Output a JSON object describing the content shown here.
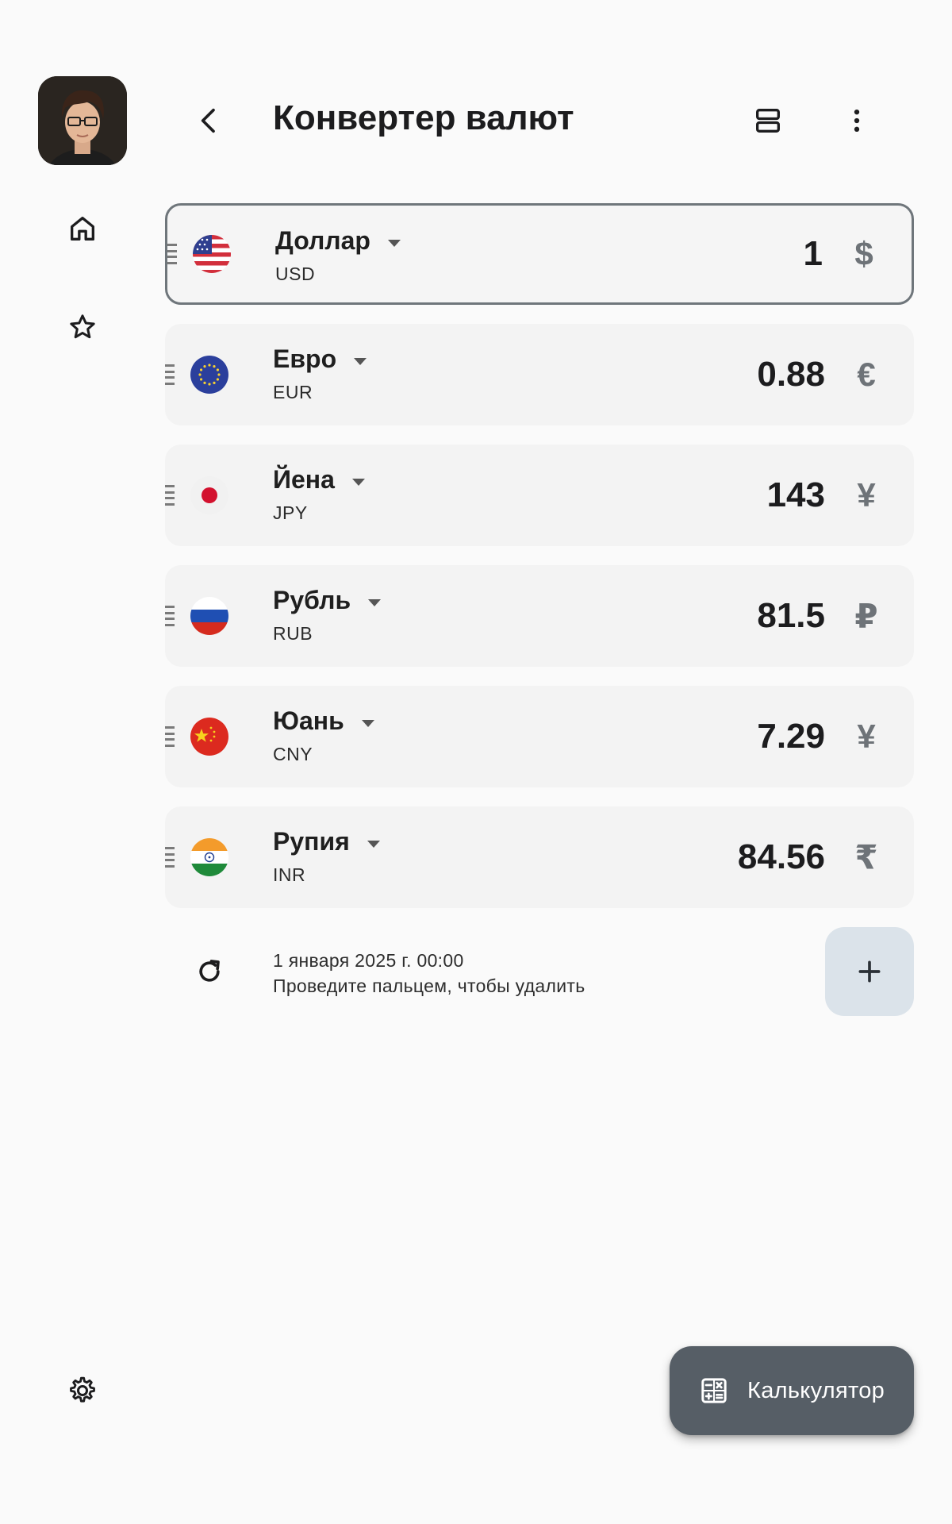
{
  "app": {
    "title": "Конвертер валют"
  },
  "nav": {
    "items": [
      {
        "icon": "home-icon"
      },
      {
        "icon": "star-icon"
      }
    ],
    "settings_icon": "gear-icon"
  },
  "toolbar": {
    "back_icon": "arrow-back-icon",
    "view_icon": "view-agenda-icon",
    "more_icon": "more-vert-icon"
  },
  "currencies": [
    {
      "name": "Доллар",
      "code": "USD",
      "amount": "1",
      "symbol": "$",
      "flag": "us-flag",
      "base": true
    },
    {
      "name": "Евро",
      "code": "EUR",
      "amount": "0.88",
      "symbol": "€",
      "flag": "eu-flag",
      "base": false
    },
    {
      "name": "Йена",
      "code": "JPY",
      "amount": "143",
      "symbol": "¥",
      "flag": "jp-flag",
      "base": false
    },
    {
      "name": "Рубль",
      "code": "RUB",
      "amount": "81.5",
      "symbol": "₽",
      "flag": "ru-flag",
      "base": false
    },
    {
      "name": "Юань",
      "code": "CNY",
      "amount": "7.29",
      "symbol": "¥",
      "flag": "cn-flag",
      "base": false
    },
    {
      "name": "Рупия",
      "code": "INR",
      "amount": "84.56",
      "symbol": "₹",
      "flag": "in-flag",
      "base": false
    }
  ],
  "info": {
    "updated": "1 января 2025 г. 00:00",
    "hint": "Проведите пальцем, чтобы удалить"
  },
  "fab": {
    "label": "Калькулятор"
  },
  "colors": {
    "background": "#fafafa",
    "card": "#f3f3f3",
    "base_border": "#6f767b",
    "add_button": "#dbe3ea",
    "fab": "#565e66"
  }
}
